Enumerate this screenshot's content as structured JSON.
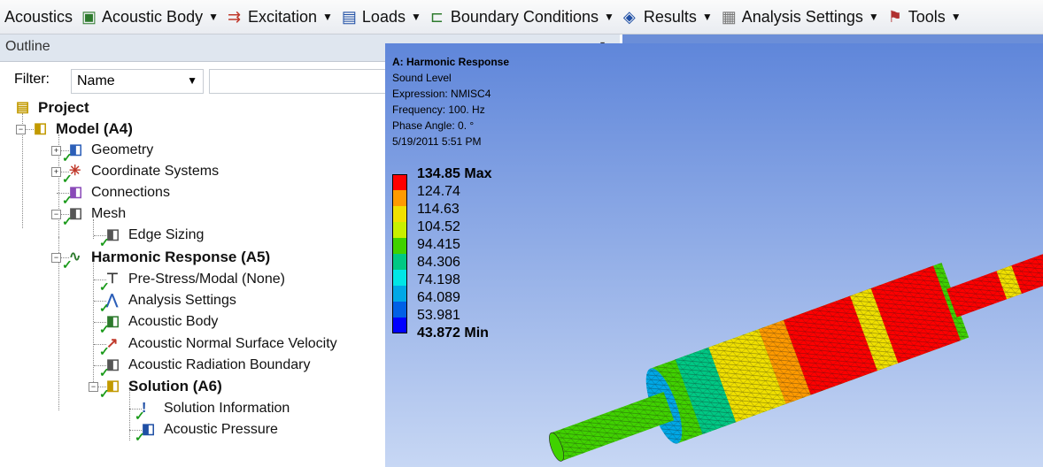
{
  "toolbar": {
    "items": [
      {
        "label": "Acoustics",
        "icon": "none",
        "has_arrow": false
      },
      {
        "label": "Acoustic Body",
        "icon": "acoustic-body-icon",
        "has_arrow": true
      },
      {
        "label": "Excitation",
        "icon": "excitation-icon",
        "has_arrow": true
      },
      {
        "label": "Loads",
        "icon": "loads-icon",
        "has_arrow": true
      },
      {
        "label": "Boundary Conditions",
        "icon": "boundary-conditions-icon",
        "has_arrow": true
      },
      {
        "label": "Results",
        "icon": "results-icon",
        "has_arrow": true
      },
      {
        "label": "Analysis Settings",
        "icon": "analysis-settings-icon",
        "has_arrow": true
      },
      {
        "label": "Tools",
        "icon": "tools-icon",
        "has_arrow": true
      }
    ]
  },
  "outline": {
    "title": "Outline",
    "filter_label": "Filter:",
    "filter_value": "Name",
    "filter_text": ""
  },
  "tree": {
    "nodes": [
      {
        "label": "Project",
        "bold": true,
        "icon": "project-icon"
      },
      {
        "label": "Model (A4)",
        "bold": true,
        "icon": "model-icon",
        "expander": "−"
      },
      {
        "label": "Geometry",
        "icon": "geometry-icon",
        "expander": "+",
        "check": true
      },
      {
        "label": "Coordinate Systems",
        "icon": "coordinate-systems-icon",
        "expander": "+",
        "check": true
      },
      {
        "label": "Connections",
        "icon": "connections-icon",
        "check": true
      },
      {
        "label": "Mesh",
        "icon": "mesh-icon",
        "expander": "−",
        "check": true
      },
      {
        "label": "Edge Sizing",
        "icon": "edge-sizing-icon",
        "check": true
      },
      {
        "label": "Harmonic Response (A5)",
        "bold": true,
        "icon": "harmonic-response-icon",
        "expander": "−",
        "check": true
      },
      {
        "label": "Pre-Stress/Modal (None)",
        "icon": "pre-stress-icon",
        "check": true
      },
      {
        "label": "Analysis Settings",
        "icon": "analysis-settings-tree-icon",
        "check": true
      },
      {
        "label": "Acoustic Body",
        "icon": "acoustic-body-tree-icon",
        "check": true
      },
      {
        "label": "Acoustic Normal Surface Velocity",
        "icon": "surface-velocity-icon",
        "check": true
      },
      {
        "label": "Acoustic Radiation Boundary",
        "icon": "radiation-boundary-icon",
        "check": true
      },
      {
        "label": "Solution (A6)",
        "bold": true,
        "icon": "solution-icon",
        "expander": "−",
        "check": true
      },
      {
        "label": "Solution Information",
        "icon": "solution-information-icon",
        "check": true
      },
      {
        "label": "Acoustic Pressure",
        "icon": "acoustic-pressure-icon",
        "check": true
      }
    ]
  },
  "viewport": {
    "info": {
      "title": "A: Harmonic Response",
      "result": "Sound Level",
      "expression": "Expression: NMISC4",
      "frequency": "Frequency: 100. Hz",
      "phase": "Phase Angle: 0. °",
      "date": "5/19/2011 5:51 PM"
    },
    "legend": {
      "labels": [
        "134.85 Max",
        "124.74",
        "114.63",
        "104.52",
        "94.415",
        "84.306",
        "74.198",
        "64.089",
        "53.981",
        "43.872 Min"
      ],
      "colors": [
        "#ff0000",
        "#ff9a00",
        "#f0e000",
        "#c8f000",
        "#40d200",
        "#00c884",
        "#00e6e6",
        "#00a8e6",
        "#0060e6",
        "#0000ff"
      ]
    }
  },
  "colors": {
    "viewport_top": "#5f86da",
    "viewport_bottom": "#c7d7f4",
    "check": "#1a9a1a"
  }
}
